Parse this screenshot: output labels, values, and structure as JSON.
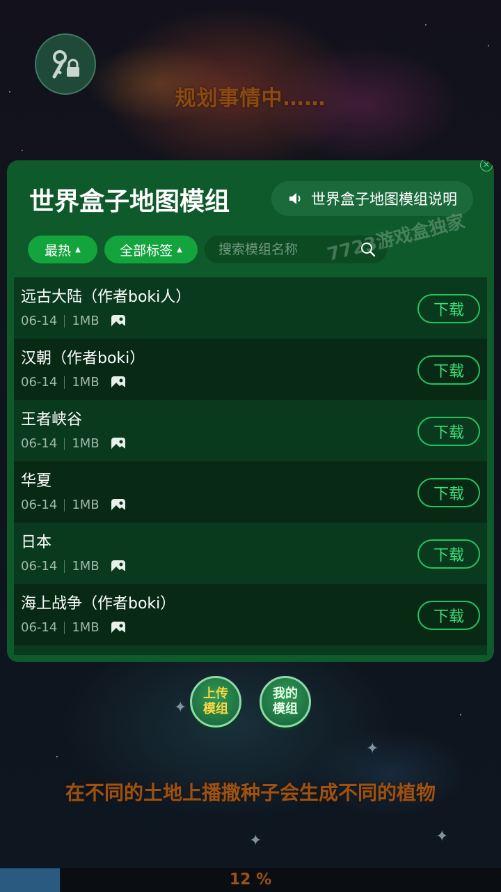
{
  "background": {
    "status_text": "规划事情中……",
    "tip_text": "在不同的土地上播撒种子会生成不同的植物",
    "progress": {
      "value_percent": 12,
      "label": "12 %"
    },
    "key_button_icon": "key-lock-icon"
  },
  "panel": {
    "title": "世界盒子地图模组",
    "description_button": {
      "label": "世界盒子地图模组说明",
      "icon": "speaker-icon"
    },
    "filters": {
      "sort_label": "最热",
      "tags_label": "全部标签",
      "search_placeholder": "搜索模组名称"
    },
    "watermark": "7723游戏盒独家",
    "close_icon": "close-icon",
    "download_label": "下载",
    "items": [
      {
        "name": "远古大陆（作者boki人）",
        "date": "06-14",
        "size": "1MB"
      },
      {
        "name": "汉朝（作者boki）",
        "date": "06-14",
        "size": "1MB"
      },
      {
        "name": "王者峡谷",
        "date": "06-14",
        "size": "1MB"
      },
      {
        "name": "华夏",
        "date": "06-14",
        "size": "1MB"
      },
      {
        "name": "日本",
        "date": "06-14",
        "size": "1MB"
      },
      {
        "name": "海上战争（作者boki）",
        "date": "06-14",
        "size": "1MB"
      }
    ]
  },
  "bottom_buttons": {
    "upload": {
      "line1": "上传",
      "line2": "模组"
    },
    "mine": {
      "line1": "我的",
      "line2": "模组"
    }
  },
  "colors": {
    "panel": "#0e5a2a",
    "pill": "#13a43d",
    "download_border": "#23c35c",
    "status_text": "#8a4a14"
  }
}
